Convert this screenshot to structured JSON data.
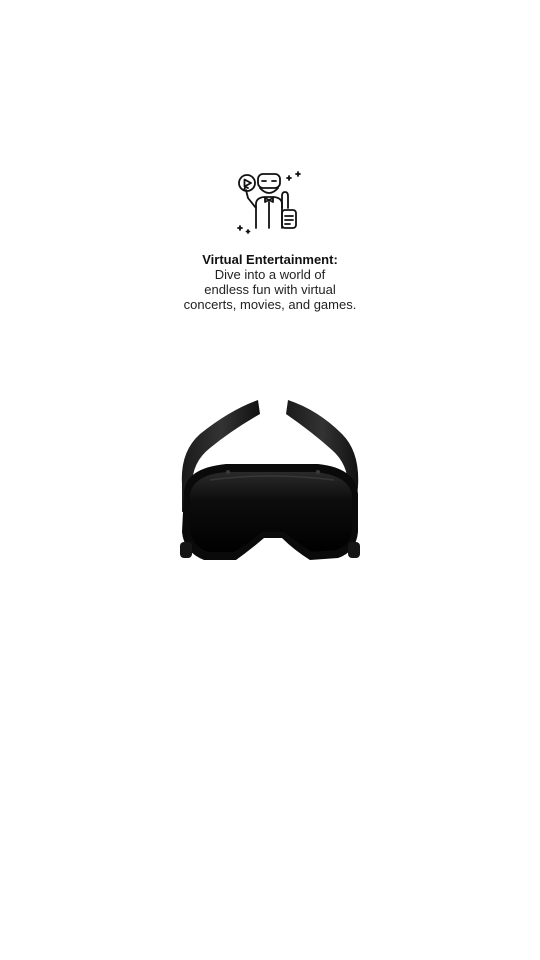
{
  "feature": {
    "icon": "vr-entertainment-person-icon",
    "title": "Virtual Entertainment:",
    "description_lines": [
      "Dive into a world of",
      "endless fun with virtual",
      "concerts, movies, and games."
    ]
  },
  "product_image": {
    "icon": "vr-headset-image"
  },
  "colors": {
    "background": "#ffffff",
    "text": "#111111",
    "headset": "#0b0b0b"
  }
}
